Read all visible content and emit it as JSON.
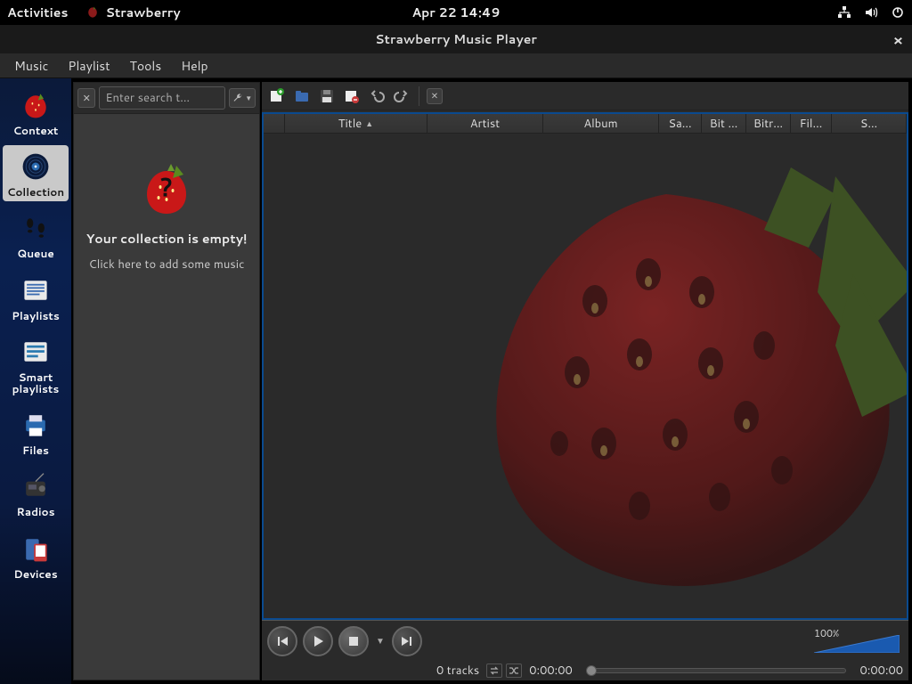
{
  "gnome": {
    "activities": "Activities",
    "appname": "Strawberry",
    "clock": "Apr 22  14:49"
  },
  "window": {
    "title": "Strawberry Music Player"
  },
  "menubar": [
    "Music",
    "Playlist",
    "Tools",
    "Help"
  ],
  "sidebar": {
    "items": [
      {
        "label": "Context"
      },
      {
        "label": "Collection"
      },
      {
        "label": "Queue"
      },
      {
        "label": "Playlists"
      },
      {
        "label": "Smart playlists"
      },
      {
        "label": "Files"
      },
      {
        "label": "Radios"
      },
      {
        "label": "Devices"
      }
    ],
    "active_index": 1
  },
  "collection": {
    "search_placeholder": "Enter search t…",
    "empty_title": "Your collection is empty!",
    "empty_subtitle": "Click here to add some music"
  },
  "playlist": {
    "columns": [
      "",
      "Title",
      "Artist",
      "Album",
      "Sa…",
      "Bit …",
      "Bitr…",
      "Fil…",
      "S…"
    ],
    "sort_column_index": 1
  },
  "controls": {
    "volume_label": "100%"
  },
  "status": {
    "tracks": "0 tracks",
    "elapsed": "0:00:00",
    "total": "0:00:00"
  }
}
